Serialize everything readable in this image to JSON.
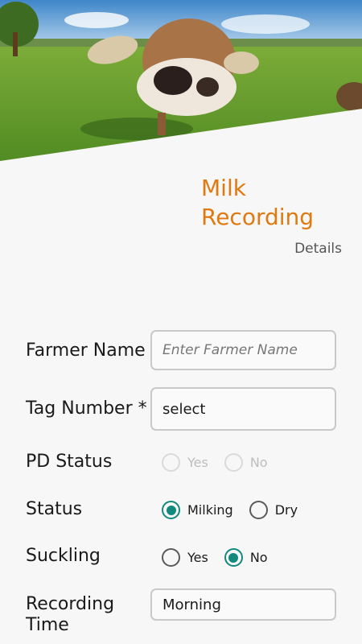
{
  "header": {
    "title": "Milk Recording",
    "subtitle": "Details",
    "image_icon": "cow-photo"
  },
  "form": {
    "farmer_name": {
      "label": "Farmer Name",
      "placeholder": "Enter Farmer Name",
      "value": ""
    },
    "tag_number": {
      "label": "Tag Number *",
      "value": "select"
    },
    "pd_status": {
      "label": "PD Status",
      "options": [
        "Yes",
        "No"
      ],
      "selected": null,
      "enabled": false
    },
    "status": {
      "label": "Status",
      "options": [
        "Milking",
        "Dry"
      ],
      "selected": "Milking"
    },
    "suckling": {
      "label": "Suckling",
      "options": [
        "Yes",
        "No"
      ],
      "selected": "No"
    },
    "recording_time": {
      "label_line1": "Recording",
      "label_line2": "Time",
      "value": "Morning"
    }
  },
  "colors": {
    "title": "#e07a10",
    "radio_checked": "#13897e"
  }
}
